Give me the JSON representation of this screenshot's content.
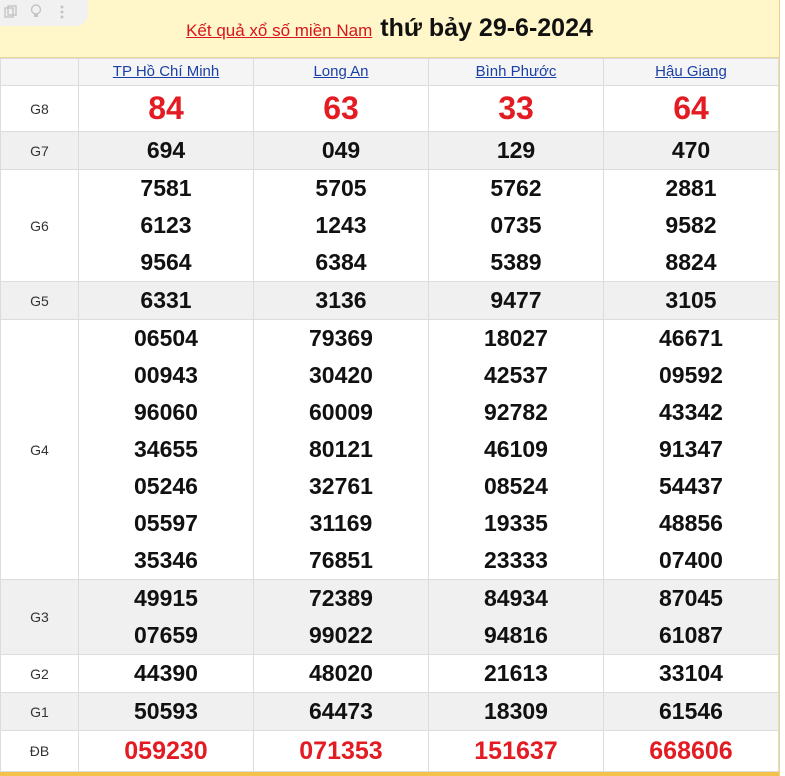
{
  "header": {
    "link_text": "Kết quả xổ số miền Nam",
    "date_text": "thứ bảy 29-6-2024"
  },
  "provinces": [
    "TP Hồ Chí Minh",
    "Long An",
    "Bình Phước",
    "Hậu Giang"
  ],
  "prizes": {
    "g8": {
      "label": "G8",
      "values": [
        "84",
        "63",
        "33",
        "64"
      ]
    },
    "g7": {
      "label": "G7",
      "values": [
        "694",
        "049",
        "129",
        "470"
      ]
    },
    "g6": {
      "label": "G6",
      "values": [
        [
          "7581",
          "6123",
          "9564"
        ],
        [
          "5705",
          "1243",
          "6384"
        ],
        [
          "5762",
          "0735",
          "5389"
        ],
        [
          "2881",
          "9582",
          "8824"
        ]
      ]
    },
    "g5": {
      "label": "G5",
      "values": [
        "6331",
        "3136",
        "9477",
        "3105"
      ]
    },
    "g4": {
      "label": "G4",
      "values": [
        [
          "06504",
          "00943",
          "96060",
          "34655",
          "05246",
          "05597",
          "35346"
        ],
        [
          "79369",
          "30420",
          "60009",
          "80121",
          "32761",
          "31169",
          "76851"
        ],
        [
          "18027",
          "42537",
          "92782",
          "46109",
          "08524",
          "19335",
          "23333"
        ],
        [
          "46671",
          "09592",
          "43342",
          "91347",
          "54437",
          "48856",
          "07400"
        ]
      ]
    },
    "g3": {
      "label": "G3",
      "values": [
        [
          "49915",
          "07659"
        ],
        [
          "72389",
          "99022"
        ],
        [
          "84934",
          "94816"
        ],
        [
          "87045",
          "61087"
        ]
      ]
    },
    "g2": {
      "label": "G2",
      "values": [
        "44390",
        "48020",
        "21613",
        "33104"
      ]
    },
    "g1": {
      "label": "G1",
      "values": [
        "50593",
        "64473",
        "18309",
        "61546"
      ]
    },
    "db": {
      "label": "ĐB",
      "values": [
        "059230",
        "071353",
        "151637",
        "668606"
      ]
    }
  },
  "colors": {
    "accent_red": "#e31b23",
    "header_bg": "#fff7c9",
    "link_blue": "#1a3fa6"
  }
}
